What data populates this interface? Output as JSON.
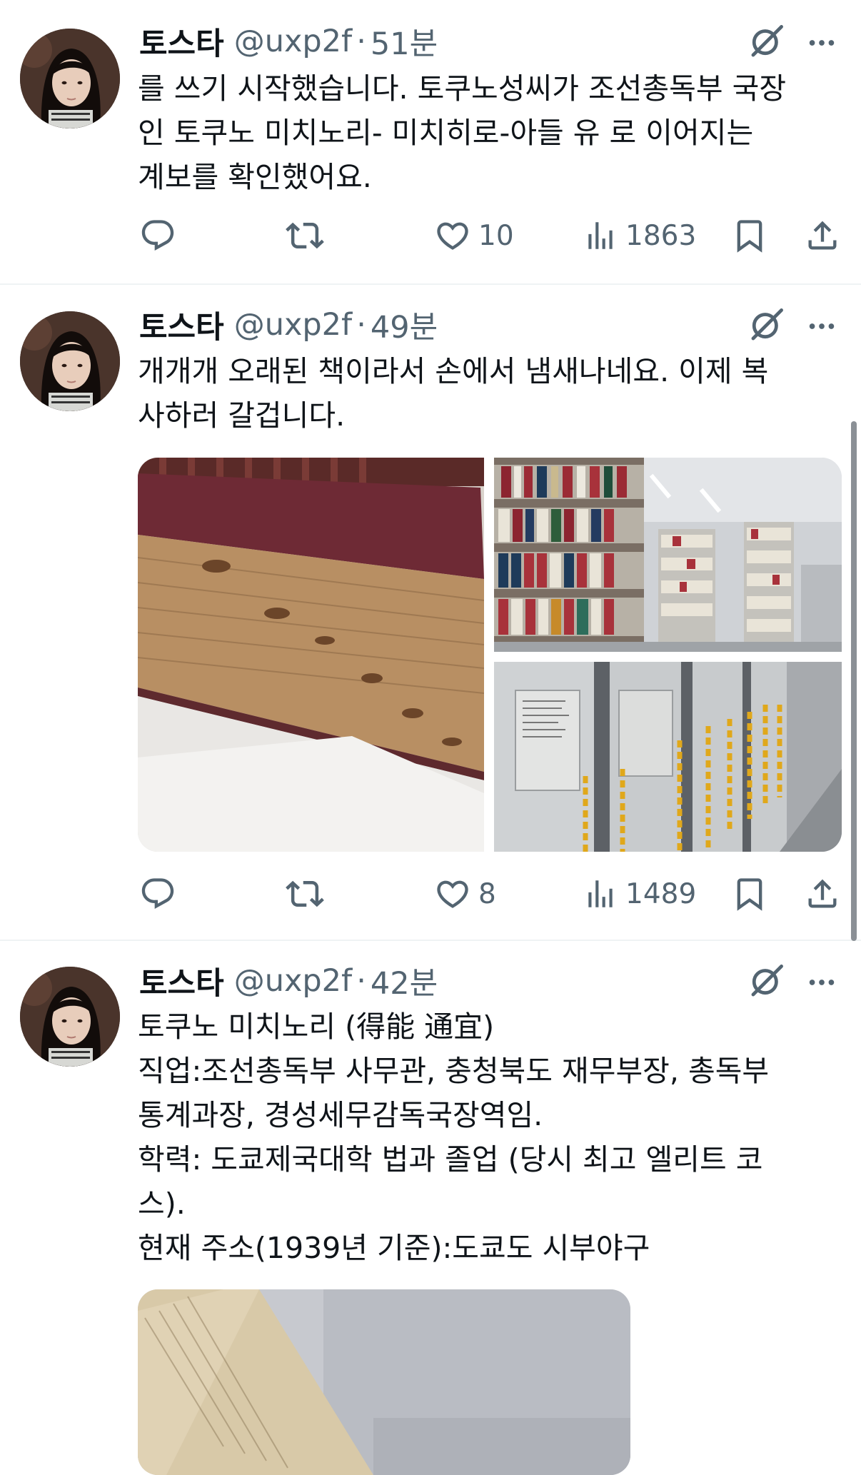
{
  "tweets": [
    {
      "author_name": "토스타",
      "handle": "@uxp2f",
      "separator": "·",
      "time": "51분",
      "lines": [
        "를 쓰기 시작했습니다. 토쿠노성씨가 조선총독부 국장",
        "인 토쿠노 미치노리- 미치히로-아들 유 로 이어지는",
        "계보를 확인했어요."
      ],
      "likes": "10",
      "views": "1863"
    },
    {
      "author_name": "토스타",
      "handle": "@uxp2f",
      "separator": "·",
      "time": "49분",
      "lines": [
        "개개개 오래된 책이라서 손에서 냄새나네요. 이제 복",
        "사하러 갈겁니다."
      ],
      "likes": "8",
      "views": "1489"
    },
    {
      "author_name": "토스타",
      "handle": "@uxp2f",
      "separator": "·",
      "time": "42분",
      "lines": [
        "토쿠노 미치노리 (得能 通宜)",
        "직업:조선총독부 사무관, 충청북도 재무부장, 총독부",
        "통계과장, 경성세무감독국장역임.",
        "학력: 도쿄제국대학 법과 졸업 (당시 최고 엘리트 코",
        "스).",
        "현재 주소(1939년 기준):도쿄도 시부야구"
      ]
    }
  ],
  "icons": {
    "reply": "reply-icon",
    "retweet": "retweet-icon",
    "like": "heart-icon",
    "views": "views-icon",
    "bookmark": "bookmark-icon",
    "share": "share-icon",
    "grok": "grok-icon",
    "more": "more-icon"
  },
  "colors": {
    "text": "#0f1419",
    "secondary": "#536471",
    "divider": "#eff3f4"
  }
}
